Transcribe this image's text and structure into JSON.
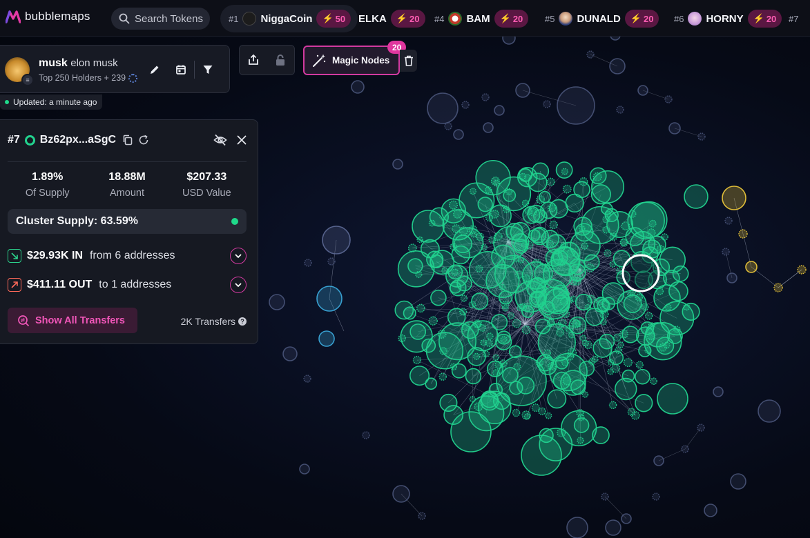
{
  "app": {
    "name": "bubblemaps"
  },
  "search": {
    "placeholder": "Search Tokens"
  },
  "ticker": [
    {
      "rank": "#1",
      "name": "NiggaCoin",
      "score": "50",
      "avatar_color": "#1c1c1c"
    },
    {
      "rank": "",
      "name": "ELKA",
      "score": "20",
      "avatar_color": ""
    },
    {
      "rank": "#4",
      "name": "BAM",
      "score": "20",
      "avatar_color": "#c23a2a"
    },
    {
      "rank": "#5",
      "name": "DUNALD",
      "score": "20",
      "avatar_color": "#d9c4b0"
    },
    {
      "rank": "#6",
      "name": "HORNY",
      "score": "20",
      "avatar_color": "#c79ad8"
    },
    {
      "rank": "#7",
      "name": "",
      "score": "",
      "avatar_color": ""
    }
  ],
  "token": {
    "symbol": "musk",
    "name": "elon musk",
    "subtitle": "Top 250 Holders + 239",
    "updated": "Updated: a minute ago"
  },
  "magic_nodes": {
    "label": "Magic Nodes",
    "count": "20"
  },
  "wallet": {
    "rank": "#7",
    "address": "Bz62px...aSgC",
    "stats": [
      {
        "value": "1.89%",
        "label": "Of Supply"
      },
      {
        "value": "18.88M",
        "label": "Amount"
      },
      {
        "value": "$207.33",
        "label": "USD Value"
      }
    ],
    "cluster_supply": "Cluster Supply: 63.59%",
    "inflow": {
      "amount": "$29.93K IN",
      "desc": "from 6 addresses"
    },
    "outflow": {
      "amount": "$411.11 OUT",
      "desc": "to 1 addresses"
    },
    "show_all": "Show All Transfers",
    "transfers": "2K Transfers"
  },
  "colors": {
    "accent": "#d23aa0",
    "green": "#22d28e",
    "yellow": "#e8c43a",
    "blue": "#3aa6d8",
    "faded": "#5a6690"
  }
}
